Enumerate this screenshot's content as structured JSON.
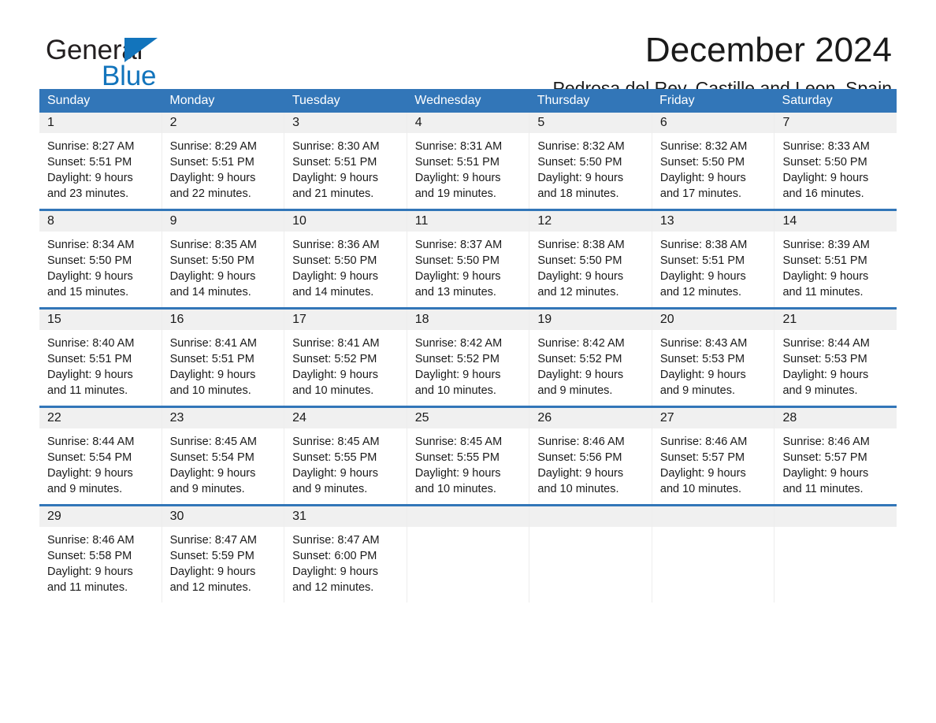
{
  "brand": {
    "name_part1": "General",
    "name_part2": "Blue",
    "logo_icon": "triangle-flag-icon",
    "color_primary": "#1274bc",
    "color_text": "#231f20"
  },
  "header": {
    "title": "December 2024",
    "subtitle": "Pedrosa del Rey, Castille and Leon, Spain"
  },
  "theme": {
    "header_blue": "#3276b8",
    "row_separator_blue": "#3276b8",
    "daynum_band_gray": "#f0f0f0",
    "page_background": "#ffffff",
    "text": "#1a1a1a"
  },
  "weekday_headers": [
    "Sunday",
    "Monday",
    "Tuesday",
    "Wednesday",
    "Thursday",
    "Friday",
    "Saturday"
  ],
  "weeks": [
    [
      {
        "day": "1",
        "sunrise": "Sunrise: 8:27 AM",
        "sunset": "Sunset: 5:51 PM",
        "daylight_1": "Daylight: 9 hours",
        "daylight_2": "and 23 minutes."
      },
      {
        "day": "2",
        "sunrise": "Sunrise: 8:29 AM",
        "sunset": "Sunset: 5:51 PM",
        "daylight_1": "Daylight: 9 hours",
        "daylight_2": "and 22 minutes."
      },
      {
        "day": "3",
        "sunrise": "Sunrise: 8:30 AM",
        "sunset": "Sunset: 5:51 PM",
        "daylight_1": "Daylight: 9 hours",
        "daylight_2": "and 21 minutes."
      },
      {
        "day": "4",
        "sunrise": "Sunrise: 8:31 AM",
        "sunset": "Sunset: 5:51 PM",
        "daylight_1": "Daylight: 9 hours",
        "daylight_2": "and 19 minutes."
      },
      {
        "day": "5",
        "sunrise": "Sunrise: 8:32 AM",
        "sunset": "Sunset: 5:50 PM",
        "daylight_1": "Daylight: 9 hours",
        "daylight_2": "and 18 minutes."
      },
      {
        "day": "6",
        "sunrise": "Sunrise: 8:32 AM",
        "sunset": "Sunset: 5:50 PM",
        "daylight_1": "Daylight: 9 hours",
        "daylight_2": "and 17 minutes."
      },
      {
        "day": "7",
        "sunrise": "Sunrise: 8:33 AM",
        "sunset": "Sunset: 5:50 PM",
        "daylight_1": "Daylight: 9 hours",
        "daylight_2": "and 16 minutes."
      }
    ],
    [
      {
        "day": "8",
        "sunrise": "Sunrise: 8:34 AM",
        "sunset": "Sunset: 5:50 PM",
        "daylight_1": "Daylight: 9 hours",
        "daylight_2": "and 15 minutes."
      },
      {
        "day": "9",
        "sunrise": "Sunrise: 8:35 AM",
        "sunset": "Sunset: 5:50 PM",
        "daylight_1": "Daylight: 9 hours",
        "daylight_2": "and 14 minutes."
      },
      {
        "day": "10",
        "sunrise": "Sunrise: 8:36 AM",
        "sunset": "Sunset: 5:50 PM",
        "daylight_1": "Daylight: 9 hours",
        "daylight_2": "and 14 minutes."
      },
      {
        "day": "11",
        "sunrise": "Sunrise: 8:37 AM",
        "sunset": "Sunset: 5:50 PM",
        "daylight_1": "Daylight: 9 hours",
        "daylight_2": "and 13 minutes."
      },
      {
        "day": "12",
        "sunrise": "Sunrise: 8:38 AM",
        "sunset": "Sunset: 5:50 PM",
        "daylight_1": "Daylight: 9 hours",
        "daylight_2": "and 12 minutes."
      },
      {
        "day": "13",
        "sunrise": "Sunrise: 8:38 AM",
        "sunset": "Sunset: 5:51 PM",
        "daylight_1": "Daylight: 9 hours",
        "daylight_2": "and 12 minutes."
      },
      {
        "day": "14",
        "sunrise": "Sunrise: 8:39 AM",
        "sunset": "Sunset: 5:51 PM",
        "daylight_1": "Daylight: 9 hours",
        "daylight_2": "and 11 minutes."
      }
    ],
    [
      {
        "day": "15",
        "sunrise": "Sunrise: 8:40 AM",
        "sunset": "Sunset: 5:51 PM",
        "daylight_1": "Daylight: 9 hours",
        "daylight_2": "and 11 minutes."
      },
      {
        "day": "16",
        "sunrise": "Sunrise: 8:41 AM",
        "sunset": "Sunset: 5:51 PM",
        "daylight_1": "Daylight: 9 hours",
        "daylight_2": "and 10 minutes."
      },
      {
        "day": "17",
        "sunrise": "Sunrise: 8:41 AM",
        "sunset": "Sunset: 5:52 PM",
        "daylight_1": "Daylight: 9 hours",
        "daylight_2": "and 10 minutes."
      },
      {
        "day": "18",
        "sunrise": "Sunrise: 8:42 AM",
        "sunset": "Sunset: 5:52 PM",
        "daylight_1": "Daylight: 9 hours",
        "daylight_2": "and 10 minutes."
      },
      {
        "day": "19",
        "sunrise": "Sunrise: 8:42 AM",
        "sunset": "Sunset: 5:52 PM",
        "daylight_1": "Daylight: 9 hours",
        "daylight_2": "and 9 minutes."
      },
      {
        "day": "20",
        "sunrise": "Sunrise: 8:43 AM",
        "sunset": "Sunset: 5:53 PM",
        "daylight_1": "Daylight: 9 hours",
        "daylight_2": "and 9 minutes."
      },
      {
        "day": "21",
        "sunrise": "Sunrise: 8:44 AM",
        "sunset": "Sunset: 5:53 PM",
        "daylight_1": "Daylight: 9 hours",
        "daylight_2": "and 9 minutes."
      }
    ],
    [
      {
        "day": "22",
        "sunrise": "Sunrise: 8:44 AM",
        "sunset": "Sunset: 5:54 PM",
        "daylight_1": "Daylight: 9 hours",
        "daylight_2": "and 9 minutes."
      },
      {
        "day": "23",
        "sunrise": "Sunrise: 8:45 AM",
        "sunset": "Sunset: 5:54 PM",
        "daylight_1": "Daylight: 9 hours",
        "daylight_2": "and 9 minutes."
      },
      {
        "day": "24",
        "sunrise": "Sunrise: 8:45 AM",
        "sunset": "Sunset: 5:55 PM",
        "daylight_1": "Daylight: 9 hours",
        "daylight_2": "and 9 minutes."
      },
      {
        "day": "25",
        "sunrise": "Sunrise: 8:45 AM",
        "sunset": "Sunset: 5:55 PM",
        "daylight_1": "Daylight: 9 hours",
        "daylight_2": "and 10 minutes."
      },
      {
        "day": "26",
        "sunrise": "Sunrise: 8:46 AM",
        "sunset": "Sunset: 5:56 PM",
        "daylight_1": "Daylight: 9 hours",
        "daylight_2": "and 10 minutes."
      },
      {
        "day": "27",
        "sunrise": "Sunrise: 8:46 AM",
        "sunset": "Sunset: 5:57 PM",
        "daylight_1": "Daylight: 9 hours",
        "daylight_2": "and 10 minutes."
      },
      {
        "day": "28",
        "sunrise": "Sunrise: 8:46 AM",
        "sunset": "Sunset: 5:57 PM",
        "daylight_1": "Daylight: 9 hours",
        "daylight_2": "and 11 minutes."
      }
    ],
    [
      {
        "day": "29",
        "sunrise": "Sunrise: 8:46 AM",
        "sunset": "Sunset: 5:58 PM",
        "daylight_1": "Daylight: 9 hours",
        "daylight_2": "and 11 minutes."
      },
      {
        "day": "30",
        "sunrise": "Sunrise: 8:47 AM",
        "sunset": "Sunset: 5:59 PM",
        "daylight_1": "Daylight: 9 hours",
        "daylight_2": "and 12 minutes."
      },
      {
        "day": "31",
        "sunrise": "Sunrise: 8:47 AM",
        "sunset": "Sunset: 6:00 PM",
        "daylight_1": "Daylight: 9 hours",
        "daylight_2": "and 12 minutes."
      },
      {
        "day": "",
        "sunrise": "",
        "sunset": "",
        "daylight_1": "",
        "daylight_2": ""
      },
      {
        "day": "",
        "sunrise": "",
        "sunset": "",
        "daylight_1": "",
        "daylight_2": ""
      },
      {
        "day": "",
        "sunrise": "",
        "sunset": "",
        "daylight_1": "",
        "daylight_2": ""
      },
      {
        "day": "",
        "sunrise": "",
        "sunset": "",
        "daylight_1": "",
        "daylight_2": ""
      }
    ]
  ]
}
